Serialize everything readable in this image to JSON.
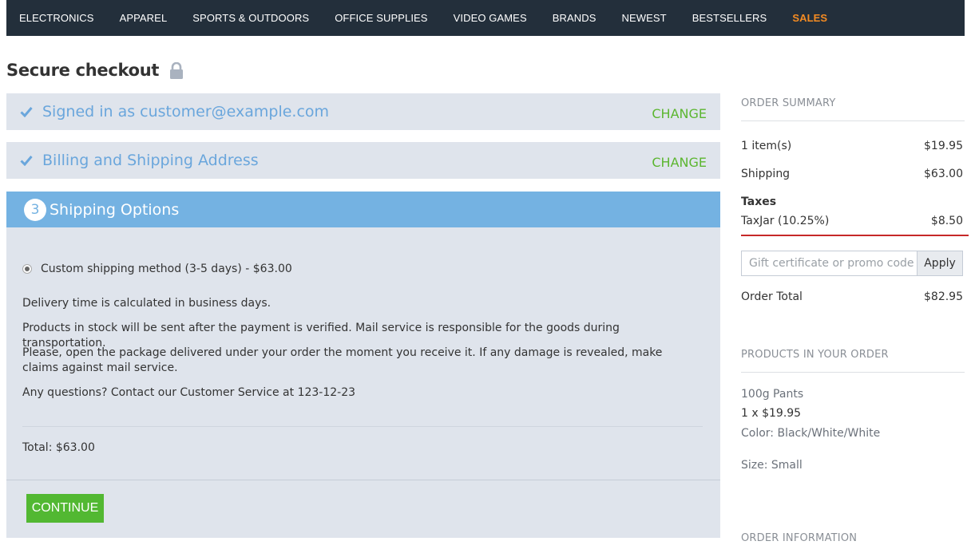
{
  "nav": {
    "items": [
      "ELECTRONICS",
      "APPAREL",
      "SPORTS & OUTDOORS",
      "OFFICE SUPPLIES",
      "VIDEO GAMES",
      "BRANDS",
      "NEWEST",
      "BESTSELLERS"
    ],
    "sales": "SALES"
  },
  "page": {
    "title": "Secure checkout"
  },
  "steps": {
    "signed_in": {
      "label": "Signed in as customer@example.com",
      "change": "CHANGE"
    },
    "address": {
      "label": "Billing and Shipping Address",
      "change": "CHANGE"
    },
    "shipping": {
      "number": "3",
      "label": "Shipping Options",
      "method": "Custom shipping method (3-5 days) - $63.00",
      "info": [
        "Delivery time is calculated in business days.",
        "Products in stock will be sent after the payment is verified. Mail service is responsible for the goods during transportation.",
        "Please, open the package delivered under your order the moment you receive it. If any damage is revealed, make claims against mail service.",
        "Any questions? Contact our Customer Service at 123-12-23"
      ],
      "total": "Total: $63.00",
      "continue": "CONTINUE"
    }
  },
  "summary": {
    "heading": "ORDER SUMMARY",
    "items_label": "1 item(s)",
    "items_value": "$19.95",
    "shipping_label": "Shipping",
    "shipping_value": "$63.00",
    "taxes_label": "Taxes",
    "tax_name": "TaxJar (10.25%)",
    "tax_value": "$8.50",
    "promo_placeholder": "Gift certificate or promo code",
    "apply": "Apply",
    "total_label": "Order Total",
    "total_value": "$82.95"
  },
  "products": {
    "heading": "PRODUCTS IN YOUR ORDER",
    "name": "100g Pants",
    "qty_price": "1 x $19.95",
    "color": "Color: Black/White/White",
    "size": "Size: Small"
  },
  "order_info": {
    "heading": "ORDER INFORMATION"
  },
  "colors": {
    "nav_bg": "#232f3b",
    "sales": "#f48b22",
    "step_bg": "#dfe4ec",
    "step_text": "#6aa6dc",
    "active_step": "#74b2e2",
    "change_link": "#5cb630",
    "continue": "#52b832",
    "red_rule": "#c62828"
  }
}
